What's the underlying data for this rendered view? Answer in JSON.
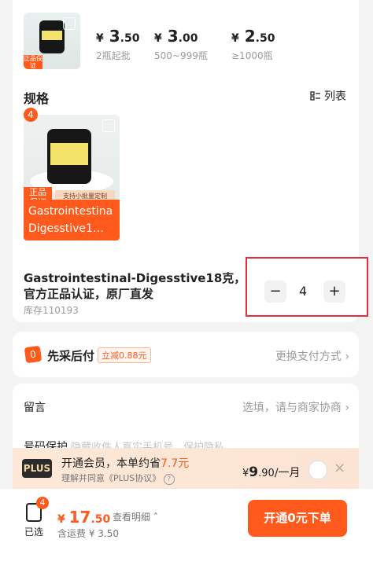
{
  "top": {
    "prices": [
      {
        "symbol": "¥",
        "main": "3",
        "decimal": ".50",
        "label": "2瓶起批"
      },
      {
        "symbol": "¥",
        "main": "3",
        "decimal": ".00",
        "label": "500~999瓶"
      },
      {
        "symbol": "¥",
        "main": "2",
        "decimal": ".50",
        "label": "≥1000瓶"
      }
    ]
  },
  "spec": {
    "title": "规格",
    "list_label": "列表",
    "badge": "4",
    "thumb_text_line1": "Gastrointestina",
    "thumb_text_line2": "Digesstive1…",
    "product_name": "Gastrointestinal-Digesstive18克，官方正品认证，原厂直发",
    "stock": "库存110193",
    "quantity": "4",
    "minus": "−",
    "plus": "+",
    "product_badge_left": "正品\n保证",
    "product_badge_right": "支持小批量定制\n代工服务 现货速发"
  },
  "payment": {
    "icon_text": "0",
    "title": "先采后付",
    "discount": "立减0.88元",
    "change": "更换支付方式"
  },
  "message": {
    "label": "留言",
    "hint": "选填，请与商家协商"
  },
  "privacy": {
    "label": "号码保护",
    "hint": "隐藏收件人真实手机号，保护隐私"
  },
  "plus": {
    "logo": "PLUS",
    "line1_prefix": "开通会员，本单约省",
    "line1_save": "7.7元",
    "line2": "理解并同意《PLUS协议》",
    "price_symbol": "¥",
    "price_main": "9",
    "price_decimal": ".90",
    "price_unit": "/一月",
    "close": "×"
  },
  "bottom": {
    "cart_count": "4",
    "cart_label": "已选",
    "total_symbol": "¥",
    "total_main": "17",
    "total_decimal": ".50",
    "detail_label": "查看明细",
    "shipping": "含运费 ¥ 3.50",
    "button_label": "开通0元下单"
  },
  "colors": {
    "accent": "#ff5a1c",
    "highlight_border": "#e02f3e"
  }
}
